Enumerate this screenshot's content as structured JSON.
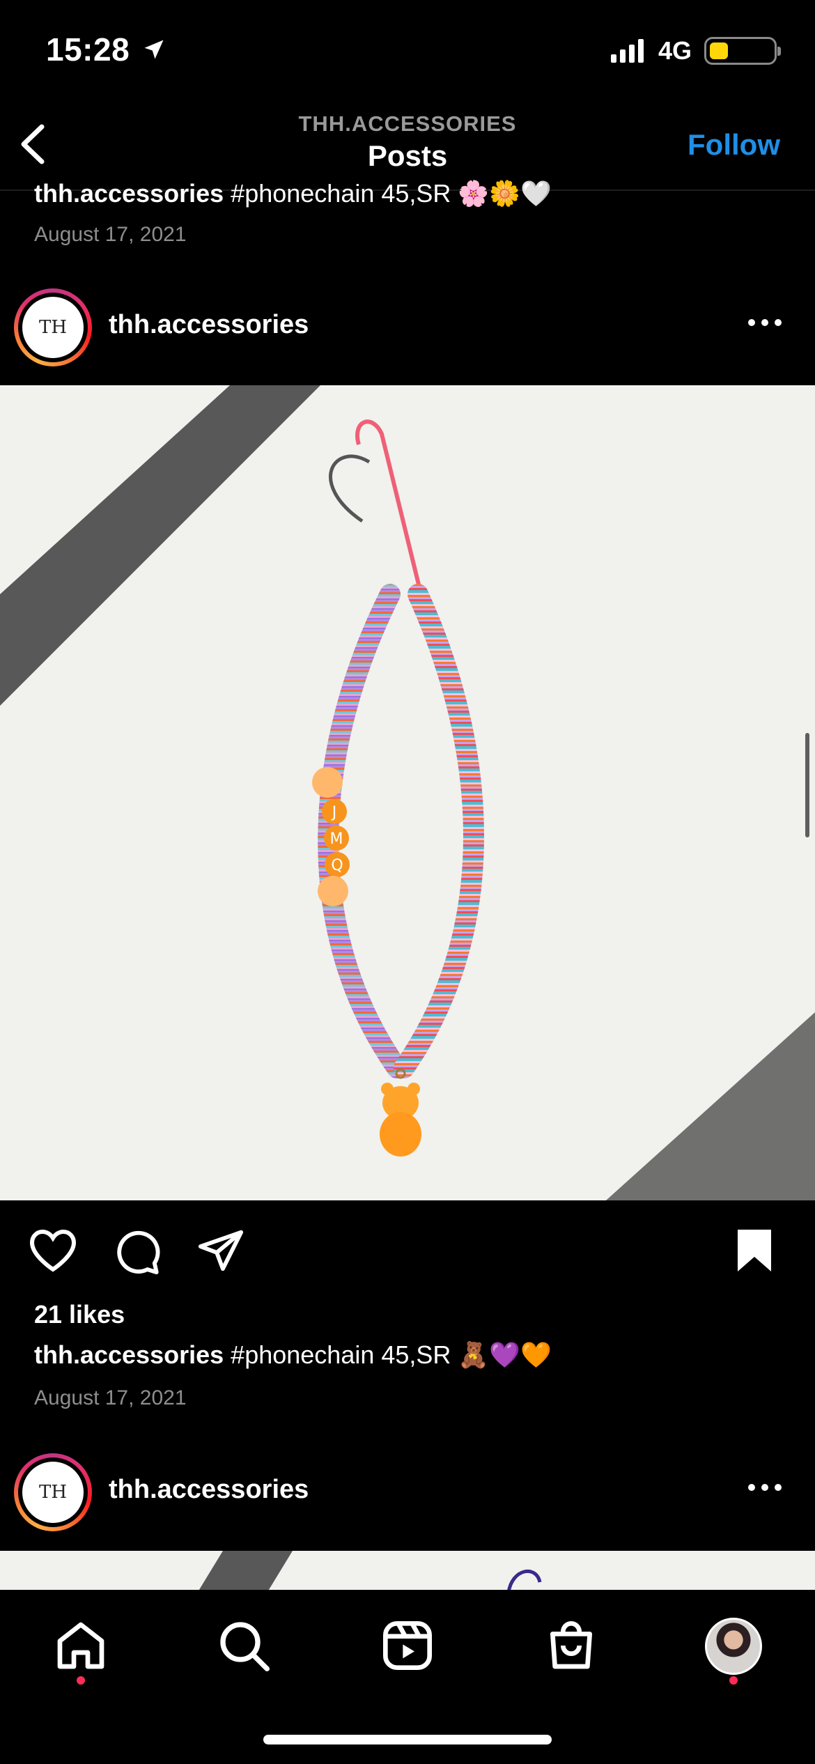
{
  "status_bar": {
    "time": "15:28",
    "network": "4G",
    "battery_level": 0.3
  },
  "header": {
    "account": "THH.ACCESSORIES",
    "title": "Posts",
    "follow_label": "Follow"
  },
  "previous_post": {
    "caption_user": "thh.accessories",
    "caption_text": "#phonechain 45,SR 🌸🌼🤍",
    "date": "August 17, 2021"
  },
  "post": {
    "username": "thh.accessories",
    "avatar_text": "TH",
    "bead_letters": [
      "J",
      "M",
      "Q"
    ],
    "likes": "21 likes",
    "caption_user": "thh.accessories",
    "caption_text": "#phonechain 45,SR 🧸💜🧡",
    "date": "August 17, 2021"
  },
  "next_post": {
    "username": "thh.accessories",
    "avatar_text": "TH"
  },
  "icons": {
    "back": "chevron-left-icon",
    "location": "location-arrow-icon",
    "signal": "signal-bars-icon",
    "battery": "battery-icon",
    "more": "more-horizontal-icon",
    "like": "heart-icon",
    "comment": "comment-icon",
    "share": "send-icon",
    "save": "bookmark-icon",
    "home": "home-icon",
    "search": "search-icon",
    "reels": "reels-icon",
    "shop": "shopping-bag-icon",
    "profile": "profile-avatar-icon"
  },
  "colors": {
    "accent": "#1e8fe8",
    "notification": "#ff2d55",
    "battery": "#ffd60a"
  }
}
